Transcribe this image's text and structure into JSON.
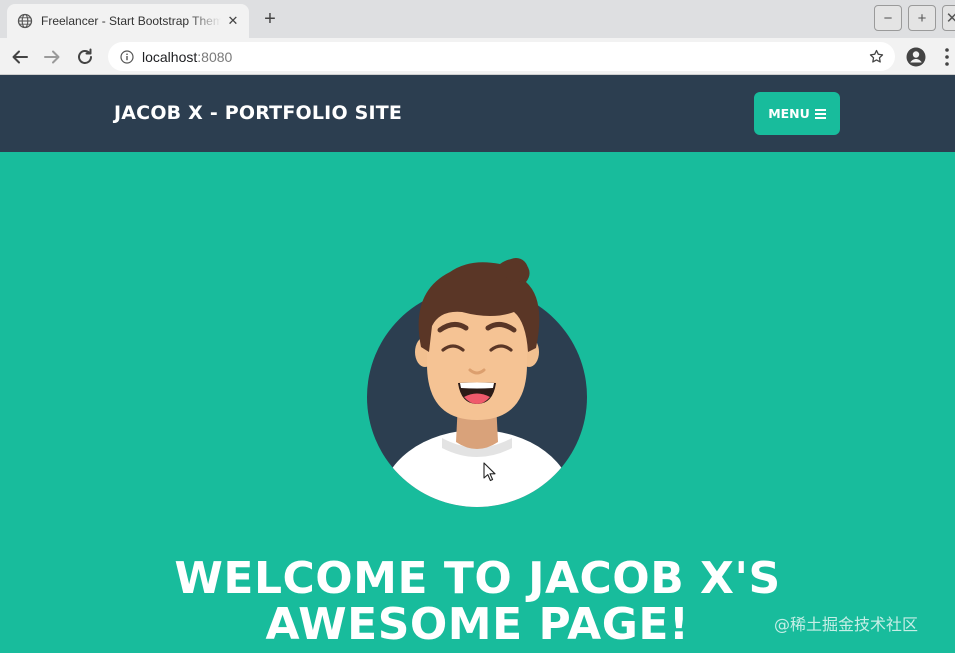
{
  "browser": {
    "tab_title": "Freelancer - Start Bootstrap Theme",
    "tab_close": "✕",
    "new_tab": "+",
    "window_buttons": {
      "minimize": "−",
      "maximize": "+",
      "close": "✕"
    },
    "url_host": "localhost",
    "url_port": ":8080",
    "icons": [
      "globe-icon",
      "back-icon",
      "forward-icon",
      "reload-icon",
      "info-icon",
      "star-icon",
      "account-icon",
      "more-icon"
    ]
  },
  "navbar": {
    "brand": "JACOB X - PORTFOLIO SITE",
    "menu_label": "MENU",
    "menu_icon": "hamburger-icon"
  },
  "masthead": {
    "heading_line1": "WELCOME TO JACOB X'S",
    "heading_line2": "AWESOME PAGE!",
    "avatar_icon": "avatar-icon"
  },
  "watermark": "@稀土掘金技术社区",
  "colors": {
    "primary": "#18bc9c",
    "secondary": "#2c3e50",
    "white": "#ffffff"
  }
}
